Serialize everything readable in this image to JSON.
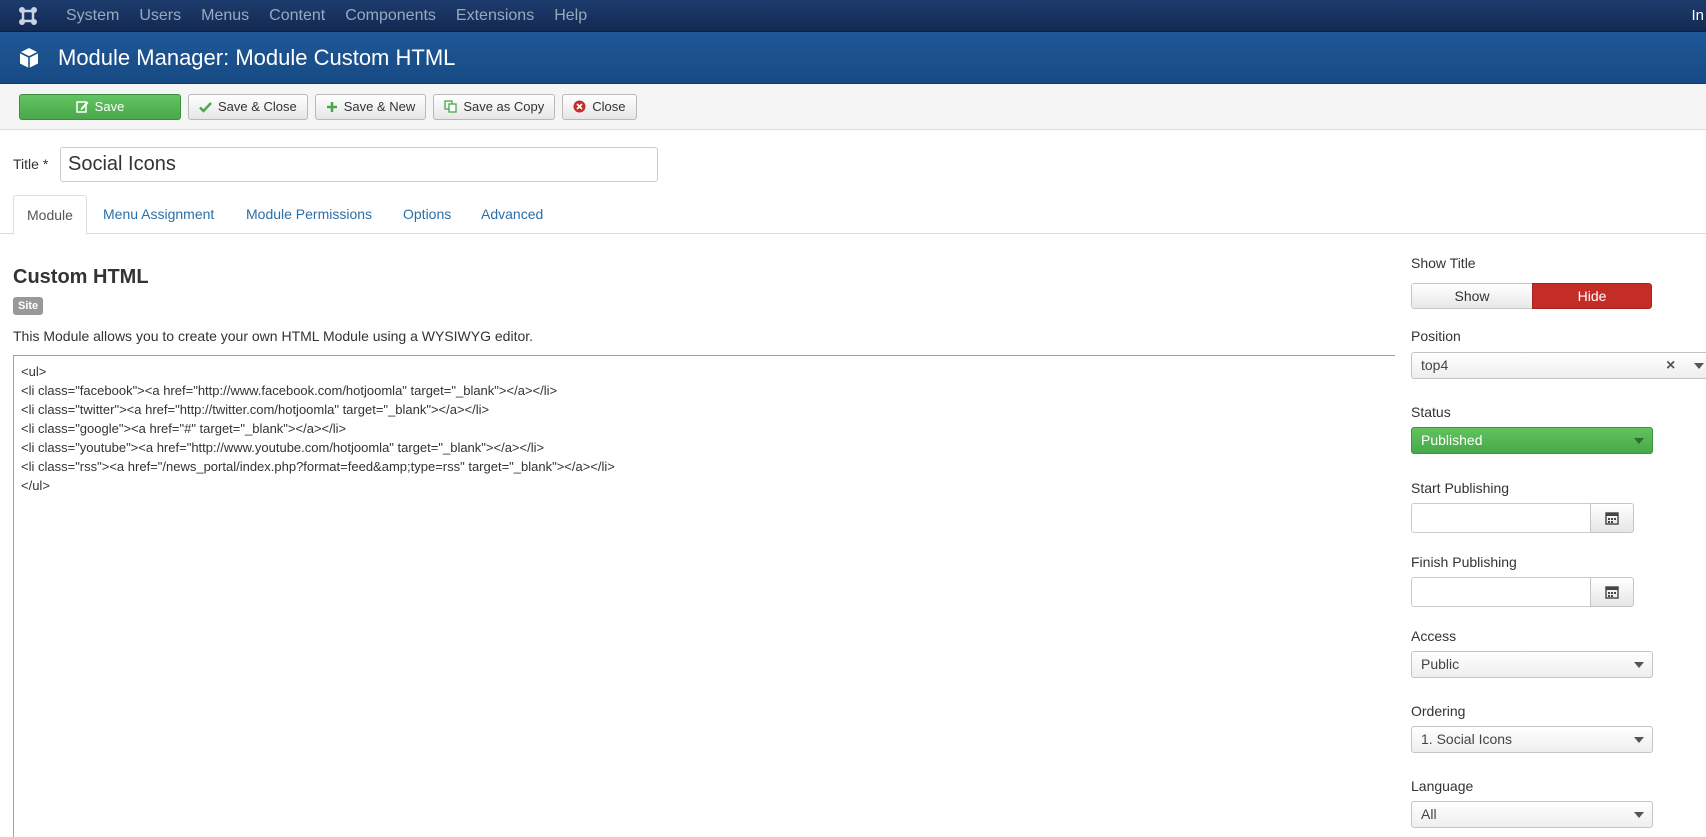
{
  "nav": {
    "items": [
      "System",
      "Users",
      "Menus",
      "Content",
      "Components",
      "Extensions",
      "Help"
    ],
    "right_text": "In"
  },
  "header": {
    "title": "Module Manager: Module Custom HTML"
  },
  "toolbar": {
    "save": "Save",
    "save_close": "Save & Close",
    "save_new": "Save & New",
    "save_copy": "Save as Copy",
    "close": "Close"
  },
  "title_field": {
    "label": "Title *",
    "value": "Social Icons"
  },
  "tabs": [
    "Module",
    "Menu Assignment",
    "Module Permissions",
    "Options",
    "Advanced"
  ],
  "main": {
    "section_title": "Custom HTML",
    "badge": "Site",
    "description": "This Module allows you to create your own HTML Module using a WYSIWYG editor.",
    "code_lines": [
      "<ul>",
      "<li class=\"facebook\"><a href=\"http://www.facebook.com/hotjoomla\" target=\"_blank\"></a></li>",
      "<li class=\"twitter\"><a href=\"http://twitter.com/hotjoomla\" target=\"_blank\"></a></li>",
      "<li class=\"google\"><a href=\"#\" target=\"_blank\"></a></li>",
      "<li class=\"youtube\"><a href=\"http://www.youtube.com/hotjoomla\" target=\"_blank\"></a></li>",
      "<li class=\"rss\"><a href=\"/news_portal/index.php?format=feed&amp;type=rss\" target=\"_blank\"></a></li>",
      "</ul>"
    ]
  },
  "sidebar": {
    "show_title": {
      "label": "Show Title",
      "show": "Show",
      "hide": "Hide",
      "selected": "Hide"
    },
    "position": {
      "label": "Position",
      "value": "top4",
      "clear": "×"
    },
    "status": {
      "label": "Status",
      "value": "Published"
    },
    "start_publishing": {
      "label": "Start Publishing",
      "value": ""
    },
    "finish_publishing": {
      "label": "Finish Publishing",
      "value": ""
    },
    "access": {
      "label": "Access",
      "value": "Public"
    },
    "ordering": {
      "label": "Ordering",
      "value": "1. Social Icons"
    },
    "language": {
      "label": "Language",
      "value": "All"
    }
  },
  "colors": {
    "navbar": "#17325d",
    "header": "#1a5290",
    "save": "#51b351",
    "hide": "#c42c28",
    "published": "#51b351"
  }
}
